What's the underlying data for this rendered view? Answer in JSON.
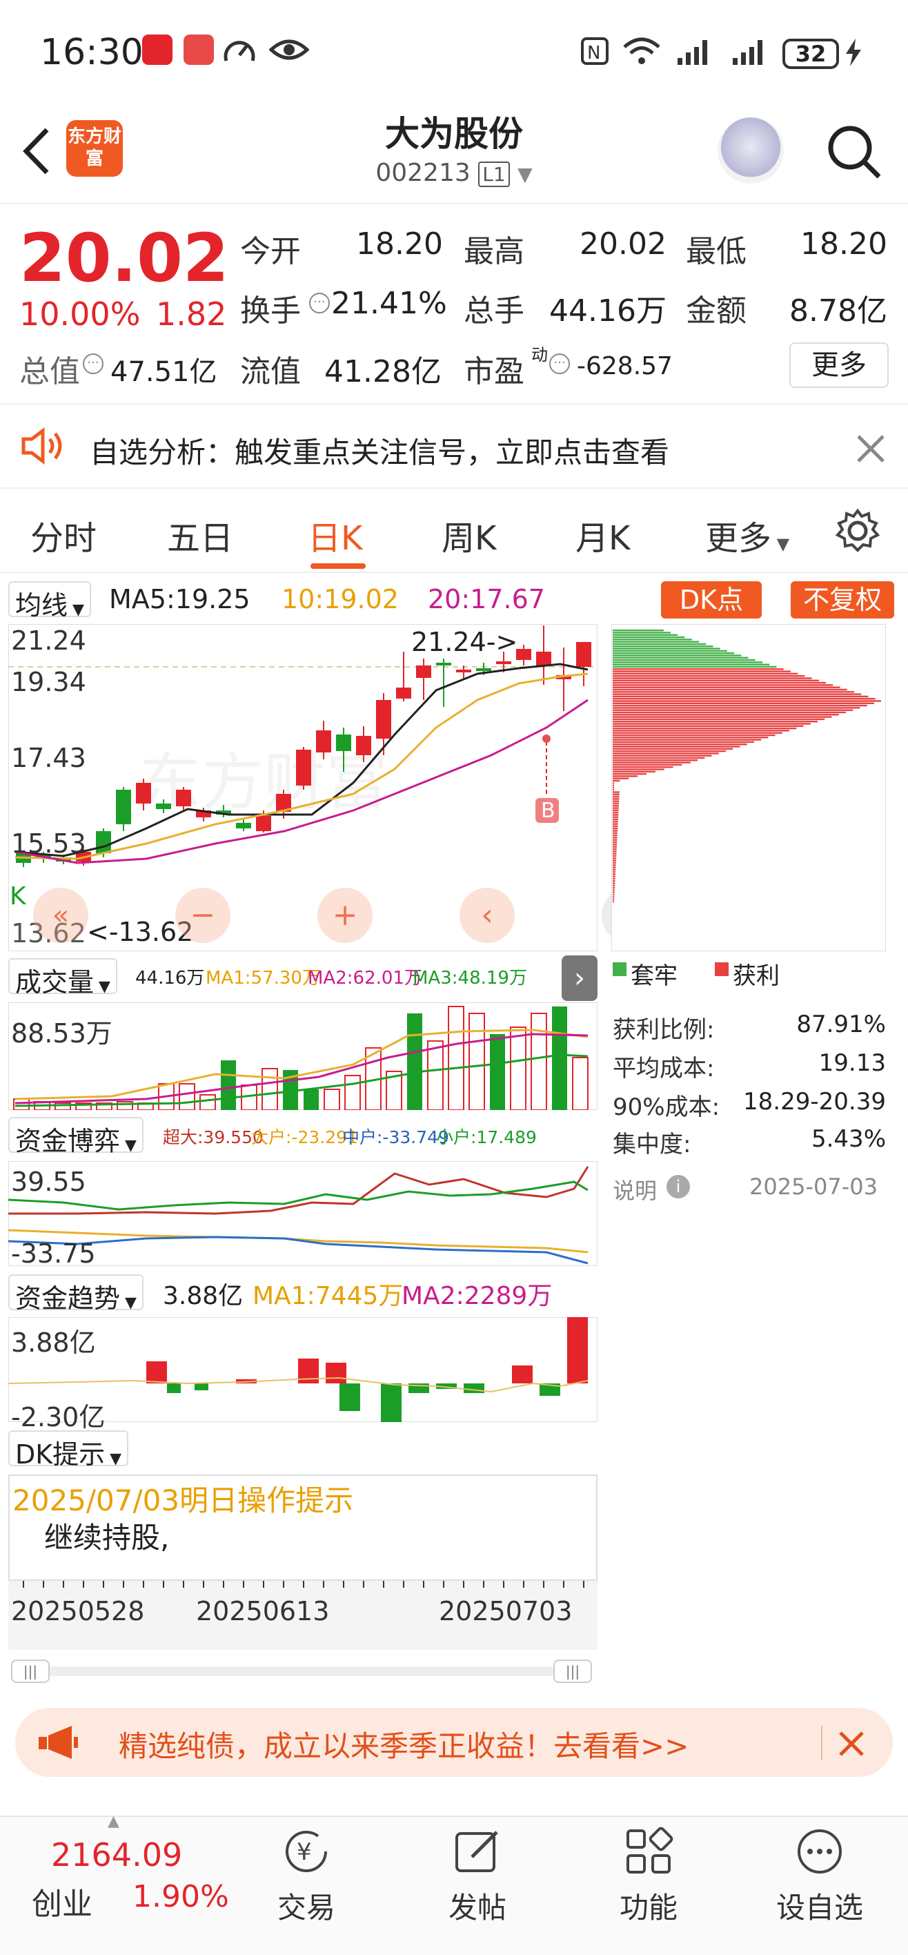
{
  "status_bar": {
    "time": "16:30",
    "battery": "32"
  },
  "header": {
    "back_label": "<",
    "logo_text": "东方财富",
    "title": "大为股份",
    "code": "002213",
    "code_badge": "L1"
  },
  "quote": {
    "price": "20.02",
    "change_pct": "10.00%",
    "change": "1.82",
    "rows": [
      [
        {
          "label": "今开",
          "value": "18.20",
          "color": "#222"
        },
        {
          "label": "最高",
          "value": "20.02",
          "color": "#e3242b"
        },
        {
          "label": "最低",
          "value": "18.20",
          "color": "#222"
        }
      ],
      [
        {
          "label": "换手",
          "value": "21.41%",
          "color": "#222"
        },
        {
          "label": "总手",
          "value": "44.16万",
          "color": "#222"
        },
        {
          "label": "金额",
          "value": "8.78亿",
          "color": "#222"
        }
      ]
    ],
    "total_value_label": "总值",
    "total_value": "47.51亿",
    "float_value_label": "流值",
    "float_value": "41.28亿",
    "pe_label": "市盈",
    "pe_sup": "动",
    "pe_value": "-628.57",
    "more_button": "更多"
  },
  "notice": {
    "text": "自选分析：触发重点关注信号，立即点击查看"
  },
  "tabs": [
    "分时",
    "五日",
    "日K",
    "周K",
    "月K",
    "更多"
  ],
  "active_tab": "日K",
  "kline": {
    "ma_selector": "均线",
    "ma5": "MA5:19.25",
    "ma10": "10:19.02",
    "ma20": "20:17.67",
    "dk_button": "DK点",
    "fq_button": "不复权",
    "y_labels": [
      "21.24",
      "19.34",
      "17.43",
      "15.53",
      "13.62"
    ],
    "high_marker": "21.24->",
    "low_marker": "<-13.62",
    "b_marker": "B",
    "k_marker": "K"
  },
  "volume": {
    "selector": "成交量",
    "vol": "44.16万",
    "ma1": "MA1:57.30万",
    "ma2": "MA2:62.01万",
    "ma3": "MA3:48.19万",
    "top_label": "88.53万"
  },
  "capital_game": {
    "selector": "资金博弈",
    "super": "超大:39.550",
    "large": "大户:-23.291",
    "mid": "中户:-33.749",
    "small": "小户:17.489",
    "top_label": "39.55",
    "bottom_label": "-33.75"
  },
  "capital_trend": {
    "selector": "资金趋势",
    "value": "3.88亿",
    "ma1": "MA1:7445万",
    "ma2": "MA2:2289万",
    "top_label": "3.88亿",
    "bottom_label": "-2.30亿"
  },
  "dk_tip": {
    "selector": "DK提示",
    "title": "2025/07/03明日操作提示",
    "body": "继续持股,"
  },
  "dates": [
    "20250528",
    "20250613",
    "20250703"
  ],
  "chip": {
    "legend_trapped": "套牢",
    "legend_profit": "获利",
    "stats": [
      {
        "label": "获利比例:",
        "value": "87.91%"
      },
      {
        "label": "平均成本:",
        "value": "19.13"
      },
      {
        "label": "90%成本:",
        "value": "18.29-20.39"
      },
      {
        "label": "集中度:",
        "value": "5.43%"
      }
    ],
    "note_label": "说明",
    "note_date": "2025-07-03"
  },
  "banner": {
    "text": "精选纯债，成立以来季季正收益！去看看>>"
  },
  "bottom_nav": {
    "index_value": "2164.09",
    "index_name": "创业",
    "index_change": "1.90%",
    "items": [
      "交易",
      "发帖",
      "功能",
      "设自选"
    ]
  },
  "colors": {
    "up": "#e3242b",
    "down": "#1a9e28",
    "accent": "#f05a22"
  }
}
